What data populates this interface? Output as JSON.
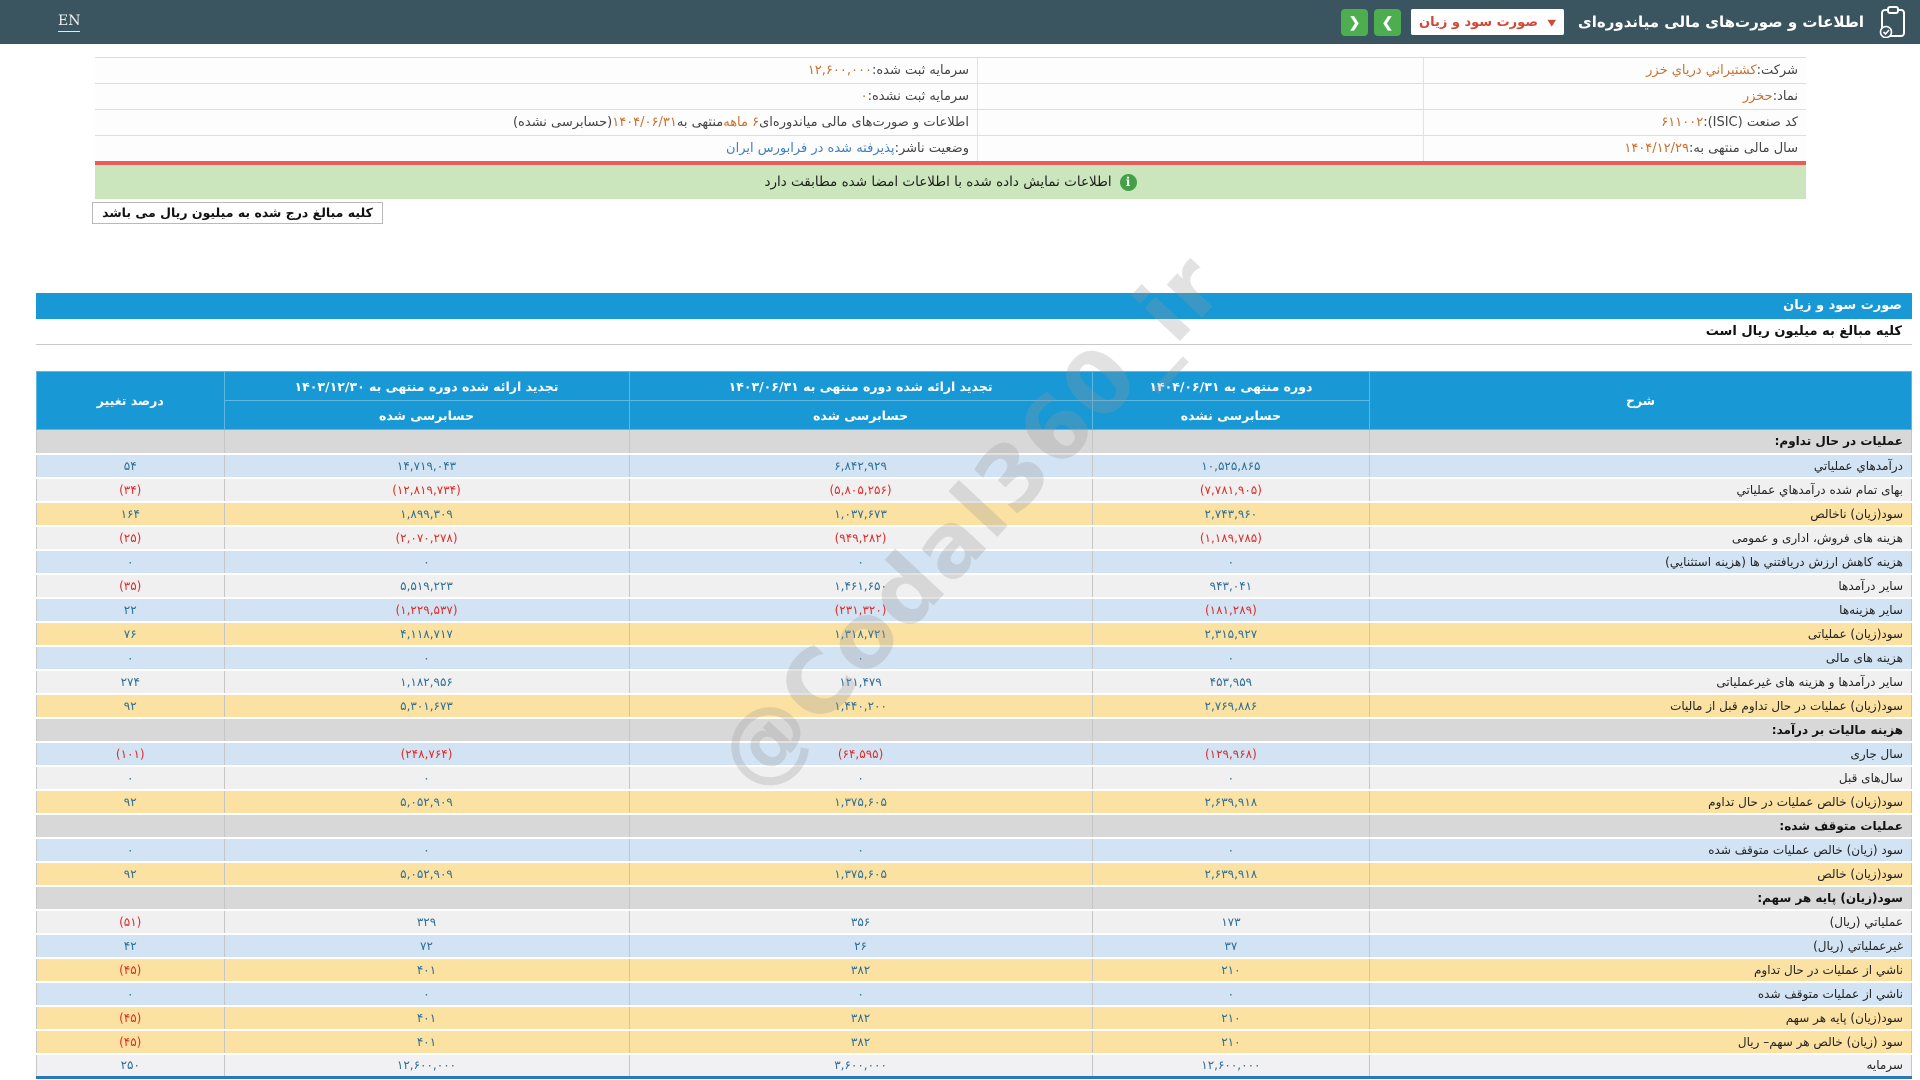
{
  "navbar": {
    "title": "اطلاعات و صورت‌های مالی میاندوره‌ای",
    "dropdown_value": "صورت سود و زیان",
    "dropdown_chevron": "▼",
    "next_icon": "❯",
    "prev_icon": "❮",
    "lang_link": "EN",
    "colors": {
      "bar": "#3b5560",
      "button_green": "#4cae4f",
      "dropdown_text": "#d14836"
    }
  },
  "company_info": {
    "rows": [
      {
        "right": [
          {
            "t": "شرکت: ",
            "c": "lab"
          },
          {
            "t": "کشتیراني درياي خزر",
            "c": "val"
          }
        ],
        "left": [
          {
            "t": "سرمایه ثبت شده: ",
            "c": "lab"
          },
          {
            "t": "۱۲,۶۰۰,۰۰۰",
            "c": "val"
          }
        ]
      },
      {
        "right": [
          {
            "t": "نماد: ",
            "c": "lab"
          },
          {
            "t": "حخزر",
            "c": "val"
          }
        ],
        "left": [
          {
            "t": "سرمایه ثبت نشده: ",
            "c": "lab"
          },
          {
            "t": "۰",
            "c": "val"
          }
        ]
      },
      {
        "right": [
          {
            "t": "کد صنعت (ISIC): ",
            "c": "lab"
          },
          {
            "t": "۶۱۱۰۰۲",
            "c": "val"
          }
        ],
        "left": [
          {
            "t": "اطلاعات و صورت‌های مالی میاندوره‌ای ",
            "c": "lab"
          },
          {
            "t": "۶ ماهه",
            "c": "val"
          },
          {
            "t": " منتهی به ",
            "c": "lab"
          },
          {
            "t": "۱۴۰۴/۰۶/۳۱",
            "c": "val"
          },
          {
            "t": "(حسابرسی نشده)",
            "c": "lab"
          }
        ]
      },
      {
        "right": [
          {
            "t": "سال مالی منتهی به: ",
            "c": "lab"
          },
          {
            "t": "۱۴۰۴/۱۲/۲۹",
            "c": "val"
          }
        ],
        "left": [
          {
            "t": "وضعیت ناشر: ",
            "c": "lab"
          },
          {
            "t": "پذیرفته شده در فرابورس ایران",
            "c": "status"
          }
        ]
      }
    ]
  },
  "banner": {
    "text": "اطلاعات نمایش داده شده با اطلاعات امضا شده مطابقت دارد"
  },
  "note_box": {
    "text": "کلیه مبالغ درج شده به میلیون ریال می باشد"
  },
  "statement": {
    "title": "صورت سود و زیان",
    "subtitle": "کلیه مبالغ به میلیون ریال است",
    "watermark": "@Codal360_ir",
    "header": {
      "desc": "شرح",
      "cols": [
        {
          "period": "دوره منتهی به ۱۴۰۴/۰۶/۳۱",
          "audit": "حسابرسی نشده"
        },
        {
          "period": "تجدید ارائه شده دوره منتهی به ۱۴۰۳/۰۶/۳۱",
          "audit": "حسابرسی شده"
        },
        {
          "period": "تجدید ارائه شده دوره منتهی به ۱۴۰۳/۱۲/۳۰",
          "audit": "حسابرسی شده"
        }
      ],
      "change": "درصد تغییر"
    },
    "rows": [
      {
        "type": "section",
        "label": "عملیات در حال تداوم:",
        "v": [
          "",
          "",
          "",
          ""
        ]
      },
      {
        "type": "blue",
        "label": "درآمدهاي عملیاتي",
        "v": [
          "۱۰,۵۲۵,۸۶۵",
          "۶,۸۴۲,۹۲۹",
          "۱۴,۷۱۹,۰۴۳",
          "۵۴"
        ]
      },
      {
        "type": "white",
        "label": "بهای تمام شده درآمدهاي عملیاتي",
        "v": [
          "(۷,۷۸۱,۹۰۵)",
          "(۵,۸۰۵,۲۵۶)",
          "(۱۲,۸۱۹,۷۳۴)",
          "(۳۴)"
        ]
      },
      {
        "type": "yellow",
        "label": "سود(زیان) ناخالص",
        "v": [
          "۲,۷۴۳,۹۶۰",
          "۱,۰۳۷,۶۷۳",
          "۱,۸۹۹,۳۰۹",
          "۱۶۴"
        ]
      },
      {
        "type": "white",
        "label": "هزینه های فروش، اداری و عمومی",
        "v": [
          "(۱,۱۸۹,۷۸۵)",
          "(۹۴۹,۲۸۲)",
          "(۲,۰۷۰,۲۷۸)",
          "(۲۵)"
        ]
      },
      {
        "type": "blue",
        "label": "هزینه کاهش ارزش دریافتني ها (هزینه استثنایي)",
        "v": [
          "۰",
          "۰",
          "۰",
          "۰"
        ]
      },
      {
        "type": "white",
        "label": "سایر درآمدها",
        "v": [
          "۹۴۳,۰۴۱",
          "۱,۴۶۱,۶۵۰",
          "۵,۵۱۹,۲۲۳",
          "(۳۵)"
        ]
      },
      {
        "type": "blue",
        "label": "سایر هزینه‌ها",
        "v": [
          "(۱۸۱,۲۸۹)",
          "(۲۳۱,۳۲۰)",
          "(۱,۲۲۹,۵۳۷)",
          "۲۲"
        ]
      },
      {
        "type": "yellow",
        "label": "سود(زیان) عملیاتی",
        "v": [
          "۲,۳۱۵,۹۲۷",
          "۱,۳۱۸,۷۲۱",
          "۴,۱۱۸,۷۱۷",
          "۷۶"
        ]
      },
      {
        "type": "blue",
        "label": "هزینه های مالی",
        "v": [
          "۰",
          "۰",
          "۰",
          "۰"
        ]
      },
      {
        "type": "white",
        "label": "سایر درآمدها و هزینه های غیرعملیاتی",
        "v": [
          "۴۵۳,۹۵۹",
          "۱۲۱,۴۷۹",
          "۱,۱۸۲,۹۵۶",
          "۲۷۴"
        ]
      },
      {
        "type": "yellow",
        "label": "سود(زیان) عملیات در حال تداوم قبل از مالیات",
        "v": [
          "۲,۷۶۹,۸۸۶",
          "۱,۴۴۰,۲۰۰",
          "۵,۳۰۱,۶۷۳",
          "۹۲"
        ]
      },
      {
        "type": "section",
        "label": "هزینه مالیات بر درآمد:",
        "v": [
          "",
          "",
          "",
          ""
        ]
      },
      {
        "type": "blue",
        "label": "سال جاری",
        "v": [
          "(۱۲۹,۹۶۸)",
          "(۶۴,۵۹۵)",
          "(۲۴۸,۷۶۴)",
          "(۱۰۱)"
        ]
      },
      {
        "type": "white",
        "label": "سال‌های قبل",
        "v": [
          "۰",
          "۰",
          "۰",
          "۰"
        ]
      },
      {
        "type": "yellow",
        "label": "سود(زیان) خالص عملیات در حال تداوم",
        "v": [
          "۲,۶۳۹,۹۱۸",
          "۱,۳۷۵,۶۰۵",
          "۵,۰۵۲,۹۰۹",
          "۹۲"
        ]
      },
      {
        "type": "section",
        "label": "عملیات متوقف شده:",
        "v": [
          "",
          "",
          "",
          ""
        ]
      },
      {
        "type": "blue",
        "label": "سود (زیان) خالص عملیات متوقف شده",
        "v": [
          "۰",
          "۰",
          "۰",
          "۰"
        ]
      },
      {
        "type": "yellow",
        "label": "سود(زیان) خالص",
        "v": [
          "۲,۶۳۹,۹۱۸",
          "۱,۳۷۵,۶۰۵",
          "۵,۰۵۲,۹۰۹",
          "۹۲"
        ]
      },
      {
        "type": "section",
        "label": "سود(زیان) پایه هر سهم:",
        "v": [
          "",
          "",
          "",
          ""
        ]
      },
      {
        "type": "white",
        "label": "عملیاتي (ریال)",
        "v": [
          "۱۷۳",
          "۳۵۶",
          "۳۲۹",
          "(۵۱)"
        ]
      },
      {
        "type": "blue",
        "label": "غیرعملیاتي (ریال)",
        "v": [
          "۳۷",
          "۲۶",
          "۷۲",
          "۴۲"
        ]
      },
      {
        "type": "yellow",
        "label": "ناشي از عملیات در حال تداوم",
        "v": [
          "۲۱۰",
          "۳۸۲",
          "۴۰۱",
          "(۴۵)"
        ]
      },
      {
        "type": "blue",
        "label": "ناشي از عملیات متوقف شده",
        "v": [
          "۰",
          "۰",
          "۰",
          "۰"
        ]
      },
      {
        "type": "yellow",
        "label": "سود(زیان) پایه هر سهم",
        "v": [
          "۲۱۰",
          "۳۸۲",
          "۴۰۱",
          "(۴۵)"
        ]
      },
      {
        "type": "yellow",
        "label": "سود (زیان) خالص هر سهم– ریال",
        "v": [
          "۲۱۰",
          "۳۸۲",
          "۴۰۱",
          "(۴۵)"
        ]
      },
      {
        "type": "capital",
        "label": "سرمایه",
        "v": [
          "۱۲,۶۰۰,۰۰۰",
          "۳,۶۰۰,۰۰۰",
          "۱۲,۶۰۰,۰۰۰",
          "۲۵۰"
        ]
      }
    ]
  }
}
